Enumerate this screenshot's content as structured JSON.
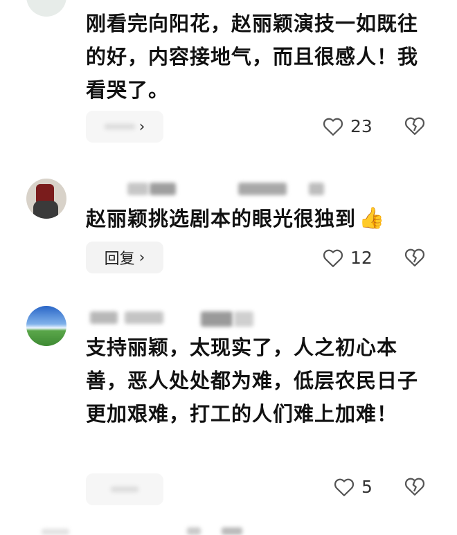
{
  "comments": [
    {
      "text": "刚看完向阳花，赵丽颖演技一如既往的好，内容接地气，而且很感人！我看哭了。",
      "reply_label": "",
      "likes": "23"
    },
    {
      "text": "赵丽颖挑选剧本的眼光很独到",
      "emoji": "👍",
      "reply_label": "回复",
      "likes": "12"
    },
    {
      "text": "支持丽颖，太现实了，人之初心本善，恶人处处都为难，低层农民日子更加艰难，打工的人们难上加难！",
      "reply_label": "",
      "likes": "5"
    }
  ],
  "icons": {
    "like": "heart-outline-icon",
    "dislike": "broken-heart-icon",
    "chevron": "›"
  }
}
